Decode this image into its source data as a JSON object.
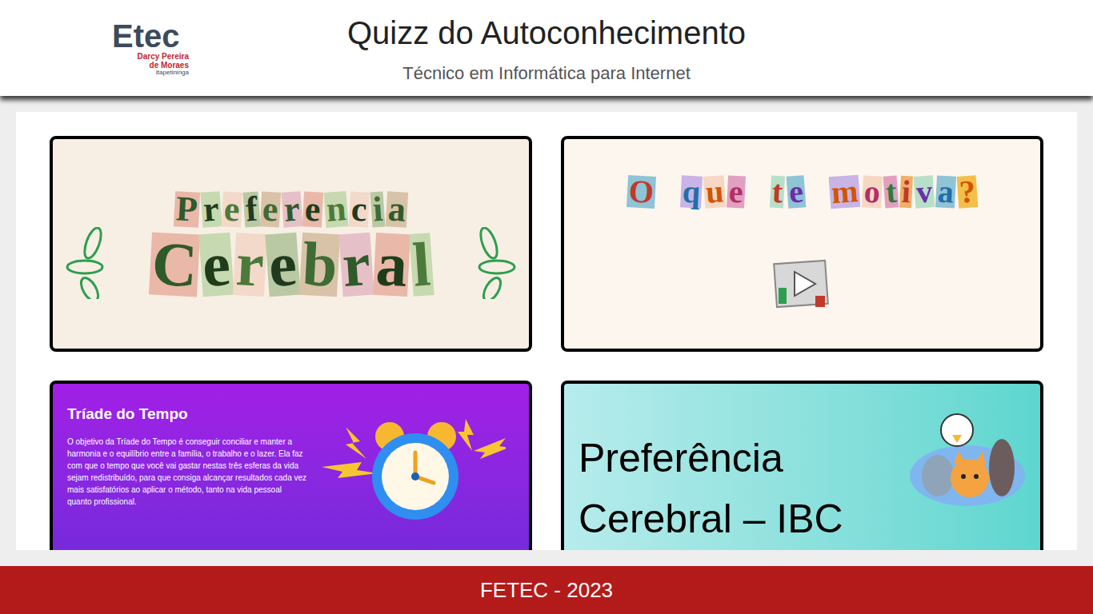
{
  "header": {
    "logo": {
      "name": "Etec",
      "school": [
        "Darcy Pereira",
        "de Moraes"
      ],
      "city": "Itapetininga"
    },
    "title": "Quizz do Autoconhecimento",
    "subtitle": "Técnico em Informática para Internet"
  },
  "cards": [
    {
      "kind": "collage",
      "lines": [
        "Preferencia",
        "Cerebral"
      ]
    },
    {
      "kind": "video",
      "lines": [
        "O que te motiva?"
      ]
    },
    {
      "kind": "info",
      "title": "Tríade do Tempo",
      "text": "O objetivo da Tríade do Tempo é conseguir conciliar e manter a harmonia e o equilíbrio entre a família, o trabalho e o lazer. Ela faz com que o tempo que você vai gastar nestas três esferas da vida sejam redistribuído, para que consiga alcançar resultados cada vez mais satisfatórios ao aplicar o método, tanto na vida pessoal quanto profissional."
    },
    {
      "kind": "banner",
      "lines": [
        "Preferência",
        "Cerebral – IBC"
      ]
    }
  ],
  "footer": "FETEC - 2023"
}
